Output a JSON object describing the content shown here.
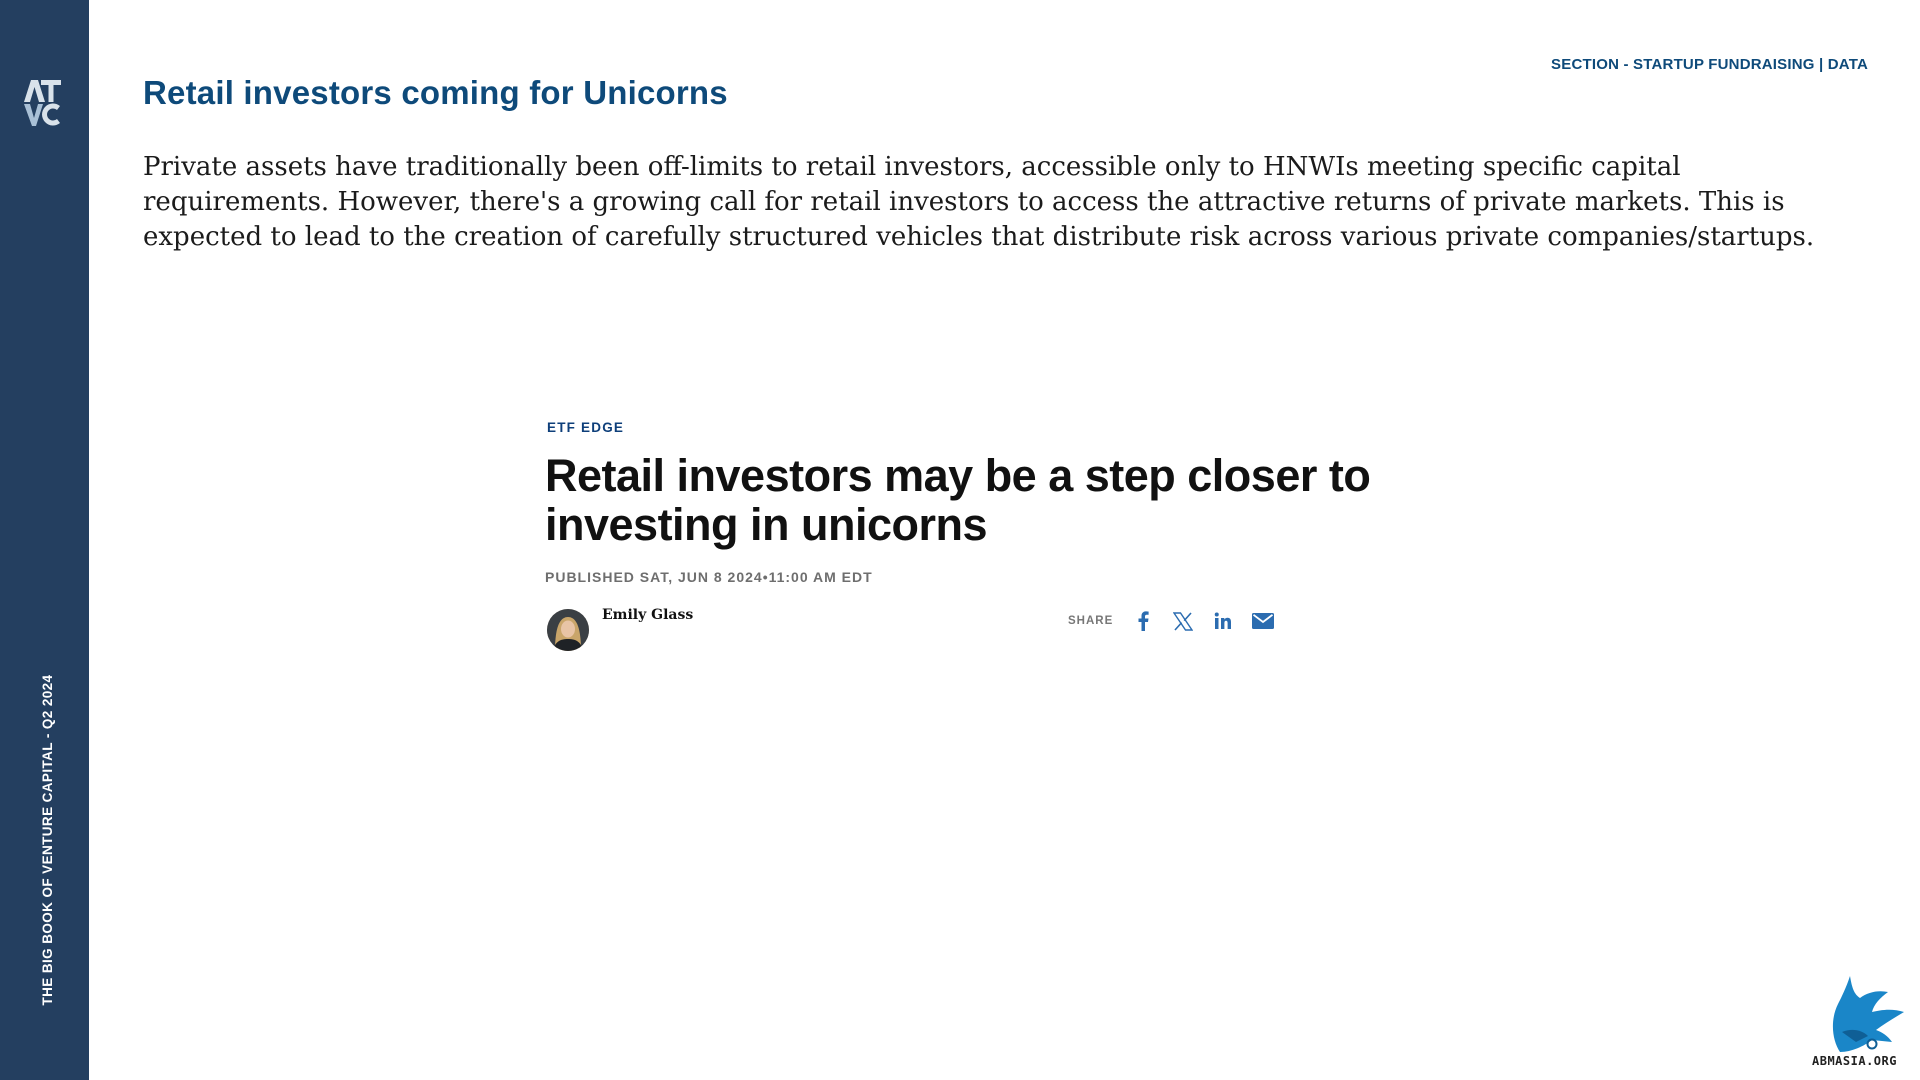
{
  "sidebar": {
    "logo_text": "ATVC",
    "vertical_title": "THE BIG BOOK OF VENTURE CAPITAL - Q2 2024"
  },
  "header": {
    "section": "SECTION - STARTUP FUNDRAISING | DATA",
    "title": "Retail investors coming for Unicorns"
  },
  "intro": "Private assets have traditionally been off-limits to retail investors, accessible only to HNWIs meeting specific capital requirements. However, there's a growing call for retail investors to access the attractive returns of private markets. This is expected to lead to the creation of carefully structured vehicles that distribute risk across various private companies/startups.",
  "article": {
    "kicker": "ETF EDGE",
    "headline": "Retail investors may be a step closer to investing in unicorns",
    "published": "PUBLISHED SAT, JUN 8 2024•11:00 AM EDT",
    "author": "Emily Glass",
    "share_label": "SHARE",
    "share_icons": [
      "facebook-icon",
      "x-icon",
      "linkedin-icon",
      "email-icon"
    ],
    "share_color": "#2b6cb0"
  },
  "watermark": {
    "text": "ABMASIA.ORG"
  },
  "colors": {
    "sidebar": "#243f60",
    "title": "#0e4a7a",
    "kicker": "#0e3f7a"
  }
}
